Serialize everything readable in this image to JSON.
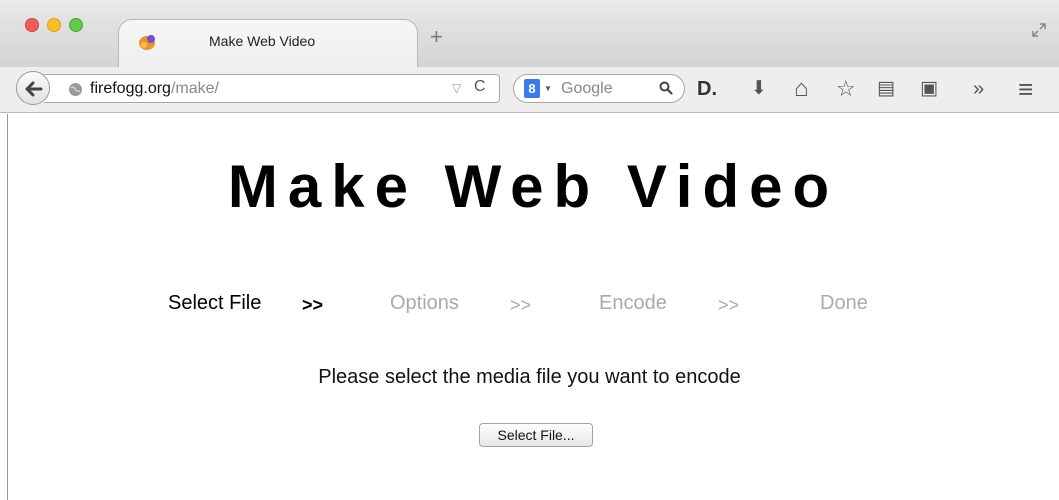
{
  "browser": {
    "tab_title": "Make Web Video",
    "new_tab_glyph": "+",
    "url_host": "firefogg.org",
    "url_path": "/make/",
    "search_engine_badge": "8",
    "search_placeholder": "Google",
    "toolbar_icons": [
      "readability-icon",
      "download-icon",
      "home-icon",
      "bookmark-star-icon",
      "reading-list-icon",
      "evernote-icon",
      "overflow-chevron-icon",
      "menu-icon"
    ],
    "icons": {
      "readability_glyph": "D.",
      "download_glyph": "⬇",
      "home_glyph": "⌂",
      "star_glyph": "☆",
      "reading_list_glyph": "▤",
      "evernote_glyph": "▣",
      "overflow_glyph": "»",
      "menu_glyph": "≡",
      "reload_glyph": "C",
      "dropdown_glyph": "▽"
    },
    "colors": {
      "close": "#ee5f58",
      "minimize": "#f9bd2e",
      "zoom": "#5fcb46",
      "google_badge": "#3b7be8"
    }
  },
  "page": {
    "heading": "Make Web Video",
    "steps": [
      {
        "label": "Select File",
        "state": "active"
      },
      {
        "label": "Options",
        "state": "inactive"
      },
      {
        "label": "Encode",
        "state": "inactive"
      },
      {
        "label": "Done",
        "state": "inactive"
      }
    ],
    "separator": ">>",
    "prompt": "Please select the media file you want to encode",
    "select_button_label": "Select File...",
    "colors": {
      "active_text": "#000000",
      "inactive_text": "#aaaaaa"
    }
  }
}
